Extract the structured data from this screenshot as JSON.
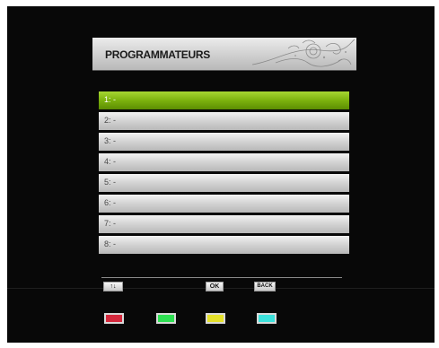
{
  "header": {
    "title": "PROGRAMMATEURS"
  },
  "list": {
    "selected_index": 0,
    "items": [
      {
        "label": "1:  -"
      },
      {
        "label": "2:  -"
      },
      {
        "label": "3:  -"
      },
      {
        "label": "4:  -"
      },
      {
        "label": "5:  -"
      },
      {
        "label": "6:  -"
      },
      {
        "label": "7:  -"
      },
      {
        "label": "8:  -"
      }
    ]
  },
  "footer": {
    "nav_label": "↑↓",
    "ok_label": "OK",
    "back_label": "BACK"
  },
  "color_keys": {
    "red": "#d4283c",
    "green": "#2ee052",
    "yellow": "#e4e02a",
    "cyan": "#3ce2dc"
  },
  "colors": {
    "selected_row": "#7cb20e",
    "row": "#d2d2d2",
    "background": "#080808"
  }
}
